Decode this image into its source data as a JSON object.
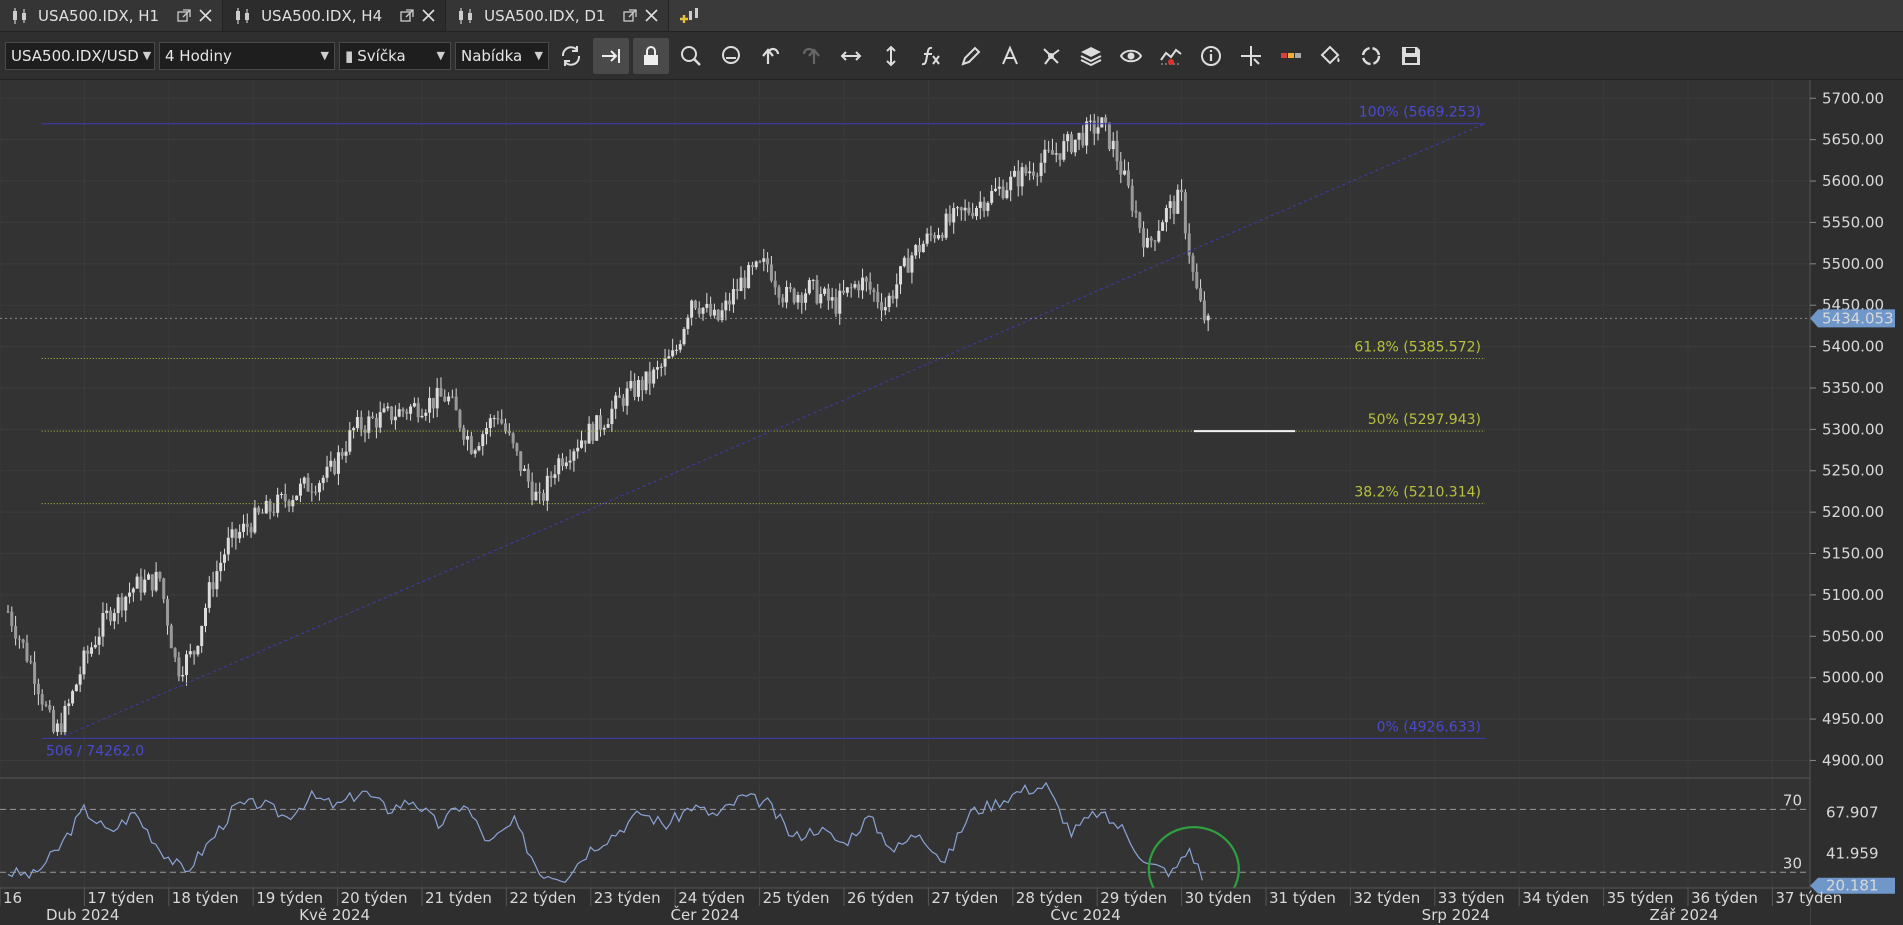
{
  "tabs": [
    {
      "label": "USA500.IDX, H1",
      "active": false
    },
    {
      "label": "USA500.IDX, H4",
      "active": true
    },
    {
      "label": "USA500.IDX, D1",
      "active": false
    }
  ],
  "toolbar": {
    "instrument": "USA500.IDX/USD",
    "period": "4 Hodiny",
    "chart_type": "Svíčka",
    "price_side": "Nabídka"
  },
  "colors": {
    "background": "#333333",
    "candle": "#dcdcdc",
    "fib_blue": "#3c3cb4",
    "fib_yellow": "#b8c03c",
    "rsi_line": "#8aa4d6",
    "price_badge": "#6f97c9",
    "circle": "#2fa040"
  },
  "chart_data": [
    {
      "type": "line",
      "name": "USA500.IDX/USD candlestick H4",
      "ylim": [
        4880,
        5710
      ],
      "yticks": [
        "5700.00",
        "5650.00",
        "5600.00",
        "5550.00",
        "5500.00",
        "5450.00",
        "5400.00",
        "5350.00",
        "5300.00",
        "5250.00",
        "5200.00",
        "5150.00",
        "5100.00",
        "5050.00",
        "5000.00",
        "4950.00",
        "4900.00"
      ],
      "week_labels": [
        "16",
        "17 týden",
        "18 týden",
        "19 týden",
        "20 týden",
        "21 týden",
        "22 týden",
        "23 týden",
        "24 týden",
        "25 týden",
        "26 týden",
        "27 týden",
        "28 týden",
        "29 týden",
        "30 týden",
        "31 týden",
        "32 týden",
        "33 týden",
        "34 týden",
        "35 týden",
        "36 týden",
        "37 týden"
      ],
      "week_x": [
        0,
        1,
        2,
        3,
        4,
        5,
        6,
        7,
        8,
        9,
        10,
        11,
        12,
        13,
        14,
        15,
        16,
        17,
        18,
        19,
        20,
        21
      ],
      "month_labels": [
        "Dub 2024",
        "Kvě 2024",
        "Čer 2024",
        "Čvc 2024",
        "Srp 2024",
        "Zář 2024"
      ],
      "month_x": [
        0.9,
        3.9,
        8.3,
        12.8,
        17.2,
        19.9
      ],
      "x": [
        0,
        0.3,
        0.55,
        0.7,
        0.9,
        1.2,
        1.5,
        1.8,
        2.0,
        2.2,
        2.4,
        2.6,
        2.9,
        3.2,
        3.5,
        3.8,
        4.1,
        4.3,
        4.6,
        4.9,
        5.2,
        5.5,
        5.8,
        6.1,
        6.3,
        6.5,
        6.8,
        7.0,
        7.3,
        7.6,
        7.9,
        8.1,
        8.4,
        8.7,
        9.0,
        9.2,
        9.5,
        9.8,
        10.1,
        10.4,
        10.7,
        11.0,
        11.3,
        11.6,
        11.9,
        12.2,
        12.5,
        12.8,
        12.95,
        13.1,
        13.3,
        13.5,
        13.7,
        13.9,
        14.05,
        14.15,
        14.25
      ],
      "y": [
        5080,
        5010,
        4930,
        4960,
        5020,
        5080,
        5110,
        5120,
        5010,
        5030,
        5110,
        5160,
        5190,
        5210,
        5230,
        5245,
        5300,
        5310,
        5320,
        5330,
        5340,
        5280,
        5320,
        5250,
        5210,
        5260,
        5290,
        5305,
        5340,
        5360,
        5390,
        5460,
        5430,
        5480,
        5500,
        5460,
        5470,
        5450,
        5480,
        5450,
        5510,
        5540,
        5560,
        5580,
        5600,
        5620,
        5640,
        5660,
        5669,
        5640,
        5580,
        5520,
        5560,
        5580,
        5480,
        5440,
        5420
      ],
      "last_price": "5434.053"
    },
    {
      "type": "line",
      "name": "Fibonacci retracement",
      "levels": [
        {
          "label": "100% (5669.253)",
          "value": 5669.253
        },
        {
          "label": "61.8% (5385.572)",
          "value": 5385.572
        },
        {
          "label": "50% (5297.943)",
          "value": 5297.943
        },
        {
          "label": "38.2% (5210.314)",
          "value": 5210.314
        },
        {
          "label": "0% (4926.633)",
          "value": 4926.633
        }
      ],
      "anchor_label": "506 / 74262.0",
      "trend_from": [
        0.6,
        4926.633
      ],
      "trend_to": [
        17.5,
        5669.253
      ],
      "extra_segment": {
        "value": 5297.943,
        "x_from": 14.05,
        "x_to": 15.25
      }
    },
    {
      "type": "line",
      "name": "RSI",
      "ylim": [
        20,
        90
      ],
      "levels": [
        70,
        30
      ],
      "level_labels": [
        "70",
        "30"
      ],
      "axis_labels": [
        "67.907",
        "41.959"
      ],
      "last_value": "20.181",
      "x": [
        0,
        0.3,
        0.6,
        0.9,
        1.2,
        1.5,
        1.8,
        2.1,
        2.4,
        2.7,
        3.0,
        3.3,
        3.6,
        3.9,
        4.2,
        4.5,
        4.8,
        5.1,
        5.4,
        5.7,
        6.0,
        6.3,
        6.6,
        6.9,
        7.2,
        7.5,
        7.8,
        8.1,
        8.4,
        8.7,
        9.0,
        9.3,
        9.6,
        9.9,
        10.2,
        10.5,
        10.8,
        11.1,
        11.4,
        11.7,
        12.0,
        12.3,
        12.6,
        12.9,
        13.2,
        13.5,
        13.8,
        14.0,
        14.2
      ],
      "y": [
        30,
        28,
        45,
        70,
        55,
        68,
        45,
        30,
        50,
        72,
        74,
        65,
        78,
        72,
        82,
        70,
        76,
        60,
        74,
        48,
        62,
        30,
        27,
        45,
        55,
        68,
        60,
        72,
        66,
        78,
        74,
        52,
        58,
        48,
        65,
        44,
        56,
        36,
        68,
        74,
        82,
        85,
        55,
        68,
        58,
        35,
        30,
        45,
        21
      ]
    }
  ]
}
